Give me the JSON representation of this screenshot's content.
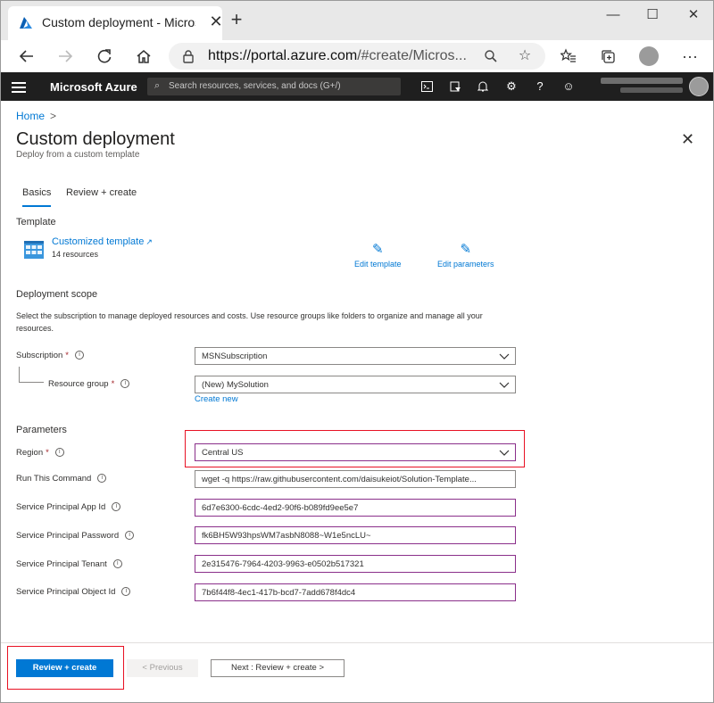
{
  "browser": {
    "tab_title": "Custom deployment - Microsoft A",
    "tab_close": "✕",
    "new_tab": "+",
    "url_host": "https://portal.azure.com",
    "url_rest": "/#create/Micros...",
    "win_min": "—",
    "win_max": "☐",
    "win_close": "✕"
  },
  "azure_header": {
    "brand": "Microsoft Azure",
    "search_placeholder": "Search resources, services, and docs (G+/)"
  },
  "breadcrumb": {
    "home": "Home",
    "sep": ">"
  },
  "page": {
    "title": "Custom deployment",
    "subtitle": "Deploy from a custom template",
    "close": "✕"
  },
  "tabs": [
    {
      "label": "Basics"
    },
    {
      "label": "Review + create"
    }
  ],
  "template": {
    "heading": "Template",
    "link": "Customized template",
    "resources": "14 resources",
    "edit_template": "Edit template",
    "edit_parameters": "Edit parameters"
  },
  "scope": {
    "heading": "Deployment scope",
    "description": "Select the subscription to manage deployed resources and costs. Use resource groups like folders to organize and manage all your resources.",
    "subscription_label": "Subscription",
    "subscription_value": "MSNSubscription",
    "resource_group_label": "Resource group",
    "resource_group_value": "(New) MySolution",
    "create_new": "Create new"
  },
  "parameters": {
    "heading": "Parameters",
    "region_label": "Region",
    "region_value": "Central US",
    "run_command_label": "Run This Command",
    "run_command_value": "wget -q https://raw.githubusercontent.com/daisukeiot/Solution-Template...",
    "app_id_label": "Service Principal App Id",
    "app_id_value": "6d7e6300-6cdc-4ed2-90f6-b089fd9ee5e7",
    "password_label": "Service Principal Password",
    "password_value": "fk6BH5W93hpsWM7asbN8088~W1e5ncLU~",
    "tenant_label": "Service Principal Tenant",
    "tenant_value": "2e315476-7964-4203-9963-e0502b517321",
    "object_id_label": "Service Principal Object Id",
    "object_id_value": "7b6f44f8-4ec1-417b-bcd7-7add678f4dc4"
  },
  "footer": {
    "review_create": "Review + create",
    "previous": "< Previous",
    "next": "Next : Review + create >"
  },
  "colors": {
    "accent": "#0078d4",
    "highlight": "#e81123"
  }
}
